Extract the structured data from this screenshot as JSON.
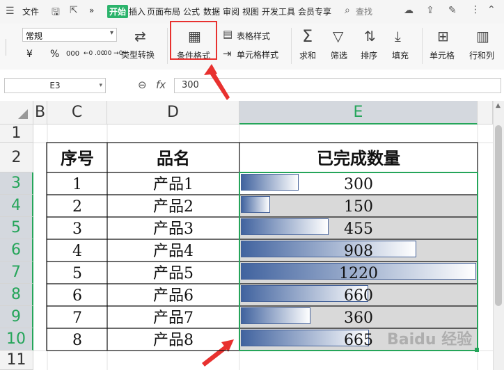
{
  "menubar": {
    "file": "文件",
    "more": "»",
    "tabs": [
      "开始",
      "插入",
      "页面布局",
      "公式",
      "数据",
      "审阅",
      "视图",
      "开发工具",
      "会员专享"
    ],
    "active_tab": "开始",
    "search": "查找"
  },
  "ribbon": {
    "number_format": "常规",
    "currency": "¥",
    "percent": "%",
    "thousands": "000",
    "dec_inc": "←0 .00",
    "dec_dec": ".00 →0",
    "type_convert": "类型转换",
    "conditional_format": "条件格式",
    "table_style": "表格样式",
    "cell_style": "单元格样式",
    "sum": "求和",
    "filter": "筛选",
    "sort": "排序",
    "fill": "填充",
    "cell": "单元格",
    "row_col": "行和列"
  },
  "formula_bar": {
    "name_box": "E3",
    "fx": "fx",
    "value": "300"
  },
  "sheet": {
    "columns": [
      "B",
      "C",
      "D",
      "E"
    ],
    "selected_column": "E",
    "rows": [
      "1",
      "2",
      "3",
      "4",
      "5",
      "6",
      "7",
      "8",
      "9",
      "10",
      "11"
    ],
    "headers": {
      "c": "序号",
      "d": "品名",
      "e": "已完成数量"
    },
    "data": [
      {
        "no": "1",
        "name": "产品1",
        "qty": "300"
      },
      {
        "no": "2",
        "name": "产品2",
        "qty": "150"
      },
      {
        "no": "3",
        "name": "产品3",
        "qty": "455"
      },
      {
        "no": "4",
        "name": "产品4",
        "qty": "908"
      },
      {
        "no": "5",
        "name": "产品5",
        "qty": "1220"
      },
      {
        "no": "6",
        "name": "产品6",
        "qty": "660"
      },
      {
        "no": "7",
        "name": "产品7",
        "qty": "360"
      },
      {
        "no": "8",
        "name": "产品8",
        "qty": "665"
      }
    ],
    "bar_max": 1220
  },
  "watermark": "Baidu 经验"
}
